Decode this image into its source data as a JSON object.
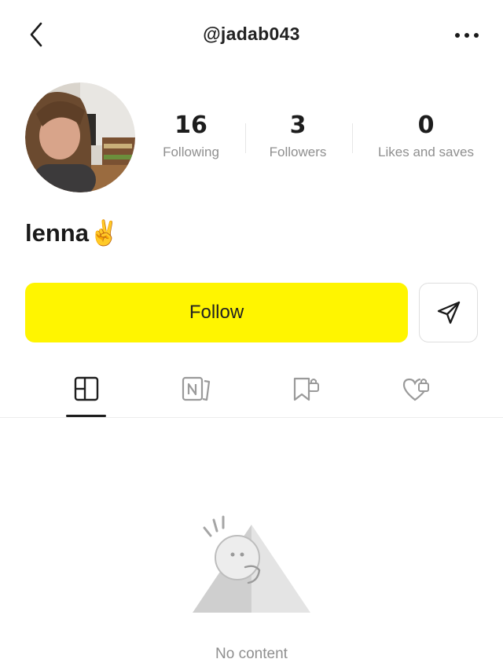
{
  "header": {
    "username": "@jadab043",
    "back_icon": "chevron-left-icon",
    "more_icon": "more-horizontal-icon"
  },
  "profile": {
    "display_name": "lenna",
    "name_emoji": "✌️"
  },
  "stats": [
    {
      "value": "16",
      "label": "Following"
    },
    {
      "value": "3",
      "label": "Followers"
    },
    {
      "value": "0",
      "label": "Likes and saves"
    }
  ],
  "actions": {
    "follow_label": "Follow",
    "follow_color": "#FFF500",
    "share_icon": "send-icon"
  },
  "tabs": [
    {
      "icon": "grid-layout-icon",
      "selected": true
    },
    {
      "icon": "notes-icon",
      "selected": false
    },
    {
      "icon": "locked-bookmark-icon",
      "selected": false
    },
    {
      "icon": "locked-heart-icon",
      "selected": false
    }
  ],
  "empty_state": {
    "text": "No content"
  }
}
